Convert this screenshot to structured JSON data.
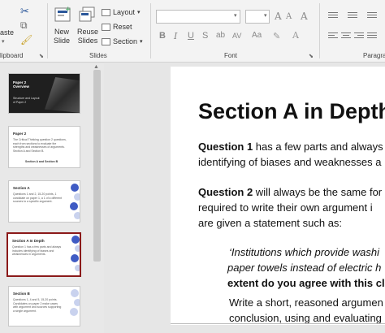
{
  "ribbon": {
    "clipboard": {
      "paste_label": "aste",
      "group_label": "lipboard",
      "launcher": "⌵"
    },
    "slides": {
      "new_slide_label": "New\nSlide",
      "reuse_slides_label": "Reuse\nSlides",
      "layout_label": "Layout",
      "reset_label": "Reset",
      "section_label": "Section",
      "group_label": "Slides"
    },
    "font": {
      "group_label": "Font",
      "bold": "B",
      "italic": "I",
      "underline": "U",
      "strike": "S",
      "shadow": "ab",
      "spacing": "AV",
      "case": "Aa",
      "grow": "A",
      "shrink": "A",
      "clear": "A"
    },
    "paragraph": {
      "group_label": "Paragra"
    }
  },
  "thumbnails": [
    {
      "title": "Paper 2 Overview",
      "text": "Structure and Layout of Paper 2"
    },
    {
      "title": "Paper 2",
      "text": "The Critical Thinking question 2 questions, each from sections to evaluate the strengths and weaknesses of arguments. Section A and Section B.",
      "footer": "Section A and Section B"
    },
    {
      "title": "Section A",
      "text": "Questions 1 and 2, 15-20 points, 1 candidate on paper 1, a 1 of a different sources to a specific argument."
    },
    {
      "title": "Section A In Depth",
      "text": "Question 1 has a few parts and always includes identifying of biases and weaknesses in arguments."
    },
    {
      "title": "Section B",
      "text": "Questions 1, 4 and 5, 15-20 points. Candidates on paper 2 make cases with argument and sources supporting a single argument."
    }
  ],
  "slide": {
    "heading": "Section A in Depth",
    "lines": [
      {
        "bold": "Question 1",
        "rest": " has a few parts and always"
      },
      {
        "bold": "",
        "rest": "identifying of biases and weaknesses a"
      },
      {
        "bold": "Question 2",
        "rest": " will always be the same for"
      },
      {
        "bold": "",
        "rest": "required to write their own argument i"
      },
      {
        "bold": "",
        "rest": "are given a statement such as:"
      }
    ],
    "quote_1": "‘Institutions which provide washi",
    "quote_2": "paper towels instead of electric h",
    "quote_3": "extent do you agree with this cla",
    "quote_4": "Write a short, reasoned argumen",
    "quote_5": "conclusion, using and evaluating"
  },
  "colors": {
    "selected_border": "#8b1a1a",
    "dot_blue": "#3f5bc4",
    "dot_light": "#c9d2ee"
  }
}
